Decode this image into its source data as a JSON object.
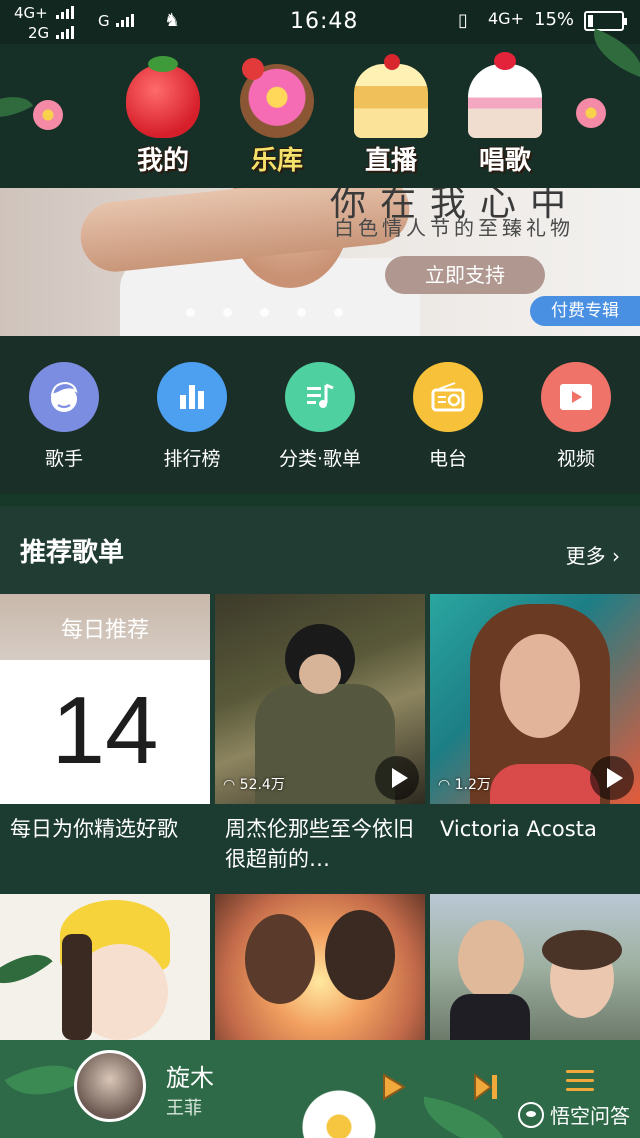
{
  "status_bar": {
    "net_top": "4G+",
    "net_bottom": "2G",
    "net_g": "G",
    "time": "16:48",
    "net_right": "4G+",
    "battery": "15%"
  },
  "top_nav": {
    "tabs": [
      {
        "label": "我的",
        "icon": "strawberry-icon",
        "active": false
      },
      {
        "label": "乐库",
        "icon": "donut-icon",
        "active": true
      },
      {
        "label": "直播",
        "icon": "cake-icon",
        "active": false
      },
      {
        "label": "唱歌",
        "icon": "cupcake-icon",
        "active": false
      }
    ],
    "active_color": "#f5e26a",
    "inactive_color": "#ffffff"
  },
  "banner": {
    "headline": "你在我心中",
    "subline": "白色情人节的至臻礼物",
    "button": "立即支持",
    "tag": "付费专辑",
    "dot_count": 5
  },
  "categories": [
    {
      "label": "歌手",
      "icon": "singer-icon",
      "color": "#7b8de0"
    },
    {
      "label": "排行榜",
      "icon": "chart-icon",
      "color": "#4d9ff0"
    },
    {
      "label": "分类·歌单",
      "icon": "playlist-icon",
      "color": "#4fd0a0"
    },
    {
      "label": "电台",
      "icon": "radio-icon",
      "color": "#f7c23a"
    },
    {
      "label": "视频",
      "icon": "video-icon",
      "color": "#f0736a"
    }
  ],
  "recommend": {
    "title": "推荐歌单",
    "more": "更多",
    "items": [
      {
        "daily_label": "每日推荐",
        "day": "14",
        "caption": "每日为你精选好歌"
      },
      {
        "plays": "52.4万",
        "caption": "周杰伦那些至今依旧很超前的…"
      },
      {
        "plays": "1.2万",
        "caption": "Victoria Acosta"
      }
    ]
  },
  "player": {
    "song": "旋木",
    "artist": "王菲"
  },
  "watermark": "悟空问答"
}
